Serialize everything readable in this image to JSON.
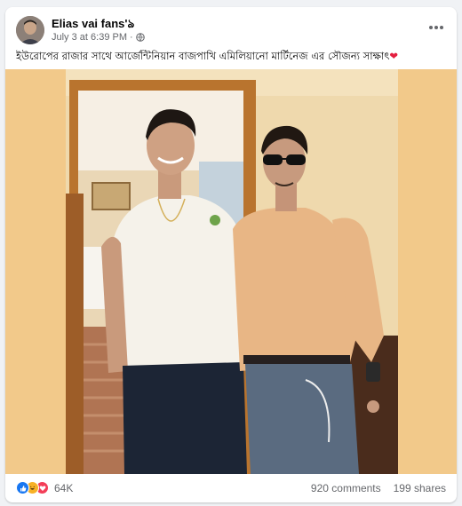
{
  "post": {
    "author": "Elias vai fans'ঌ",
    "timestamp": "July 3 at 6:39 PM",
    "separator": "·",
    "privacy_icon": "globe-icon",
    "more_icon": "more-options-icon",
    "caption": "ইউরোপের রাজার সাথে আর্জেন্টিনিয়ান বাজপাখি এমিলিয়ানো মার্টিনেজ এর সৌজন্য সাক্ষাৎ",
    "caption_emoji": "❤"
  },
  "footer": {
    "reaction_icons": [
      "like-icon",
      "haha-icon",
      "love-icon"
    ],
    "reaction_count": "64K",
    "comments": "920 comments",
    "shares": "199 shares"
  },
  "colors": {
    "accent": "#1877f2",
    "love": "#e41e3f",
    "meta_text": "#65676b",
    "photo_bg": "#f2c98a"
  }
}
